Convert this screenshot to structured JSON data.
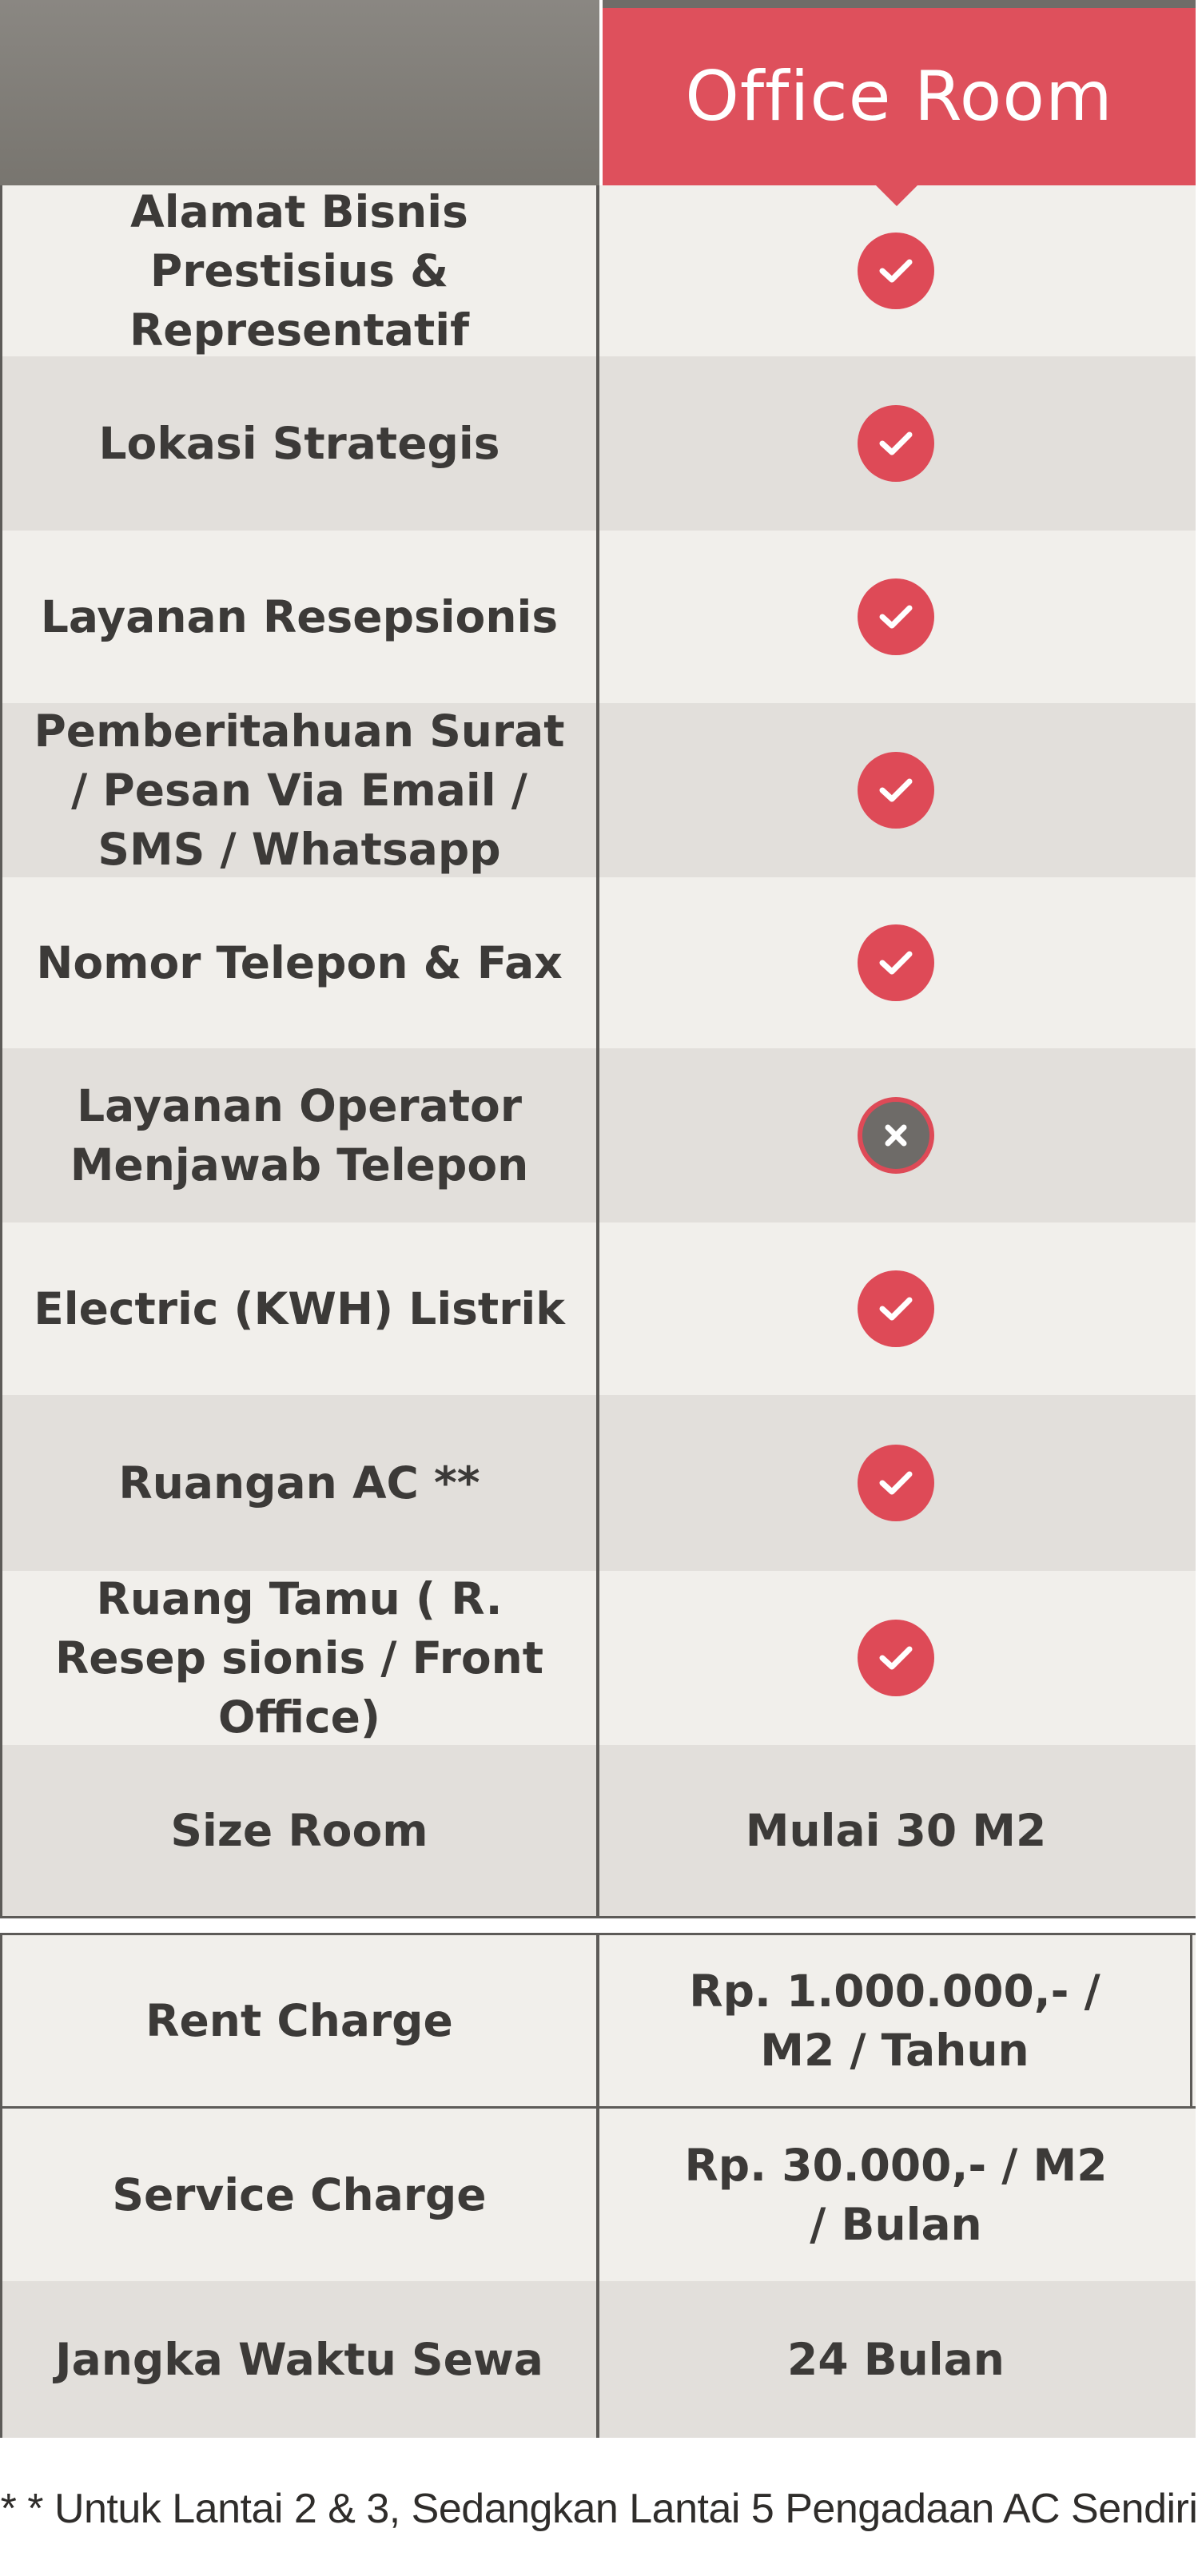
{
  "header": {
    "title": "Office Room"
  },
  "colors": {
    "accent": "#de505c",
    "header_gray": "#7d7a75",
    "row_light": "#f1efeb",
    "row_dark": "#e2dfdb"
  },
  "features": [
    {
      "label": "Alamat Bisnis Prestisius & Representatif",
      "status": "check-icon"
    },
    {
      "label": "Lokasi Strategis",
      "status": "check-icon"
    },
    {
      "label": "Layanan Resepsionis",
      "status": "check-icon"
    },
    {
      "label": "Pemberitahuan Surat / Pesan Via Email / SMS / Whatsapp",
      "status": "check-icon"
    },
    {
      "label": "Nomor Telepon & Fax",
      "status": "check-icon"
    },
    {
      "label": "Layanan Operator Menjawab Telepon",
      "status": "cross-icon"
    },
    {
      "label": "Electric (KWH) Listrik",
      "status": "check-icon"
    },
    {
      "label": "Ruangan AC **",
      "status": "check-icon"
    },
    {
      "label": "Ruang Tamu ( R. Resep sionis / Front Office)",
      "status": "check-icon"
    }
  ],
  "details": [
    {
      "label": "Size Room",
      "value": "Mulai 30 M2"
    },
    {
      "label": "Rent Charge",
      "value": "Rp. 1.000.000,- / M2 / Tahun"
    },
    {
      "label": "Service Charge",
      "value": "Rp. 30.000,- / M2 / Bulan"
    },
    {
      "label": "Jangka Waktu Sewa",
      "value": "24 Bulan"
    }
  ],
  "footnote": "* * Untuk Lantai 2 & 3, Sedangkan Lantai 5 Pengadaan AC Sendiri"
}
